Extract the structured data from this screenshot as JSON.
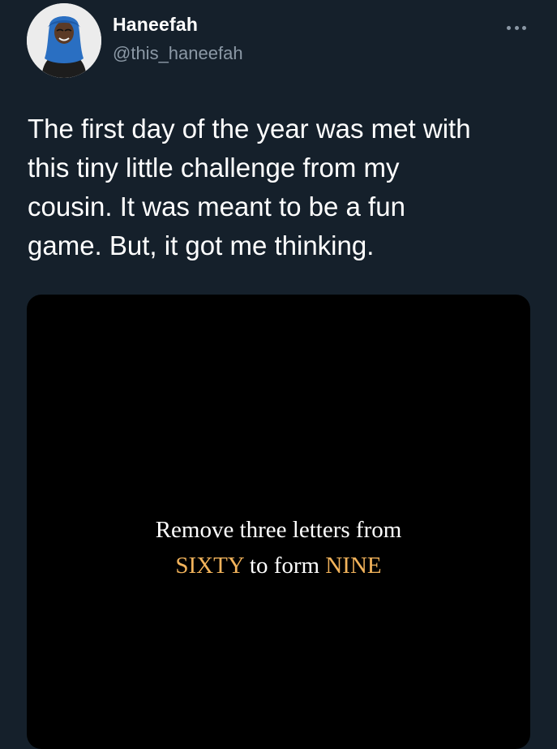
{
  "tweet": {
    "author": {
      "display_name": "Haneefah",
      "handle": "@this_haneefah",
      "avatar_icon": "user-avatar"
    },
    "more_icon": "more-horizontal-icon",
    "text_lines": [
      "The first day of the year was met with",
      "this tiny little challenge from my",
      "cousin. It was meant to be a fun",
      "game. But, it got me thinking."
    ],
    "media": {
      "line1": "Remove three letters from",
      "word1": "SIXTY",
      "middle": " to form ",
      "word2": "NINE",
      "accent_color": "#f2b35b",
      "background": "#000000"
    }
  },
  "theme": {
    "background": "#15202b",
    "text": "#ffffff",
    "secondary_text": "#8b98a5"
  }
}
